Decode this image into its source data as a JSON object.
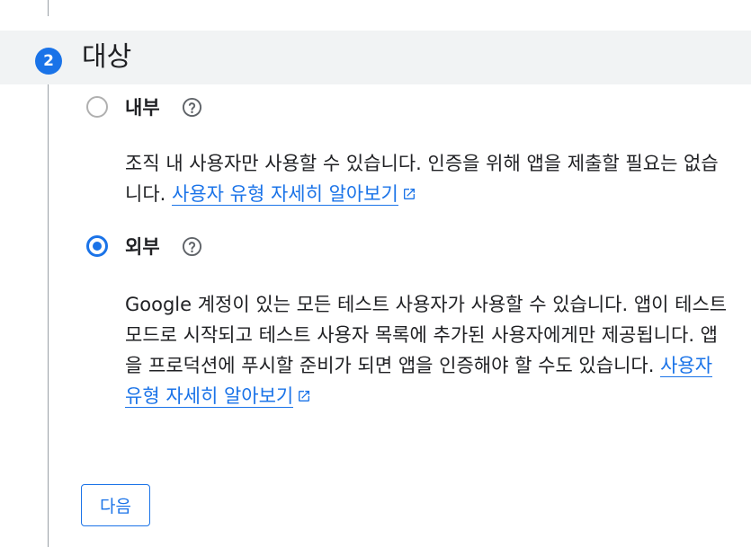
{
  "step": {
    "number": "2",
    "title": "대상"
  },
  "options": [
    {
      "label": "내부",
      "selected": false,
      "description": "조직 내 사용자만 사용할 수 있습니다. 인증을 위해 앱을 제출할 필요는 없습니다.",
      "link_text": "사용자 유형 자세히 알아보기"
    },
    {
      "label": "외부",
      "selected": true,
      "description": "Google 계정이 있는 모든 테스트 사용자가 사용할 수 있습니다. 앱이 테스트 모드로 시작되고 테스트 사용자 목록에 추가된 사용자에게만 제공됩니다. 앱을 프로덕션에 푸시할 준비가 되면 앱을 인증해야 할 수도 있습니다.",
      "link_text": "사용자 유형 자세히 알아보기"
    }
  ],
  "icons": {
    "help": "help-circle-icon",
    "external": "open-in-new-icon"
  },
  "colors": {
    "accent": "#1a73e8",
    "header_bg": "#f1f3f4"
  },
  "next_button": "다음"
}
